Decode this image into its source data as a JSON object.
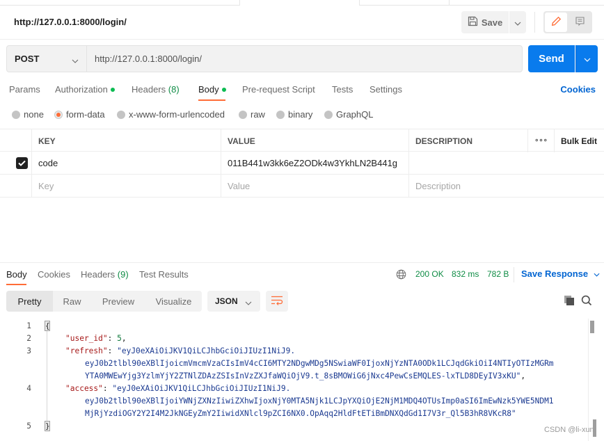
{
  "header": {
    "request_title": "http://127.0.0.1:8000/login/",
    "save_label": "Save"
  },
  "request": {
    "method": "POST",
    "url": "http://127.0.0.1:8000/login/",
    "send_label": "Send"
  },
  "request_tabs": {
    "params": "Params",
    "authorization": "Authorization",
    "headers": "Headers",
    "headers_count": "(8)",
    "body": "Body",
    "pre_request": "Pre-request Script",
    "tests": "Tests",
    "settings": "Settings",
    "cookies": "Cookies",
    "active": "Body"
  },
  "body_types": {
    "options": [
      "none",
      "form-data",
      "x-www-form-urlencoded",
      "raw",
      "binary",
      "GraphQL"
    ],
    "selected": "form-data"
  },
  "form_table": {
    "headers": {
      "key": "KEY",
      "value": "VALUE",
      "description": "DESCRIPTION",
      "more": "∘∘∘",
      "bulk_edit": "Bulk Edit"
    },
    "rows": [
      {
        "enabled": true,
        "key": "code",
        "value": "011B441w3kk6eZ2ODk4w3YkhLN2B441g",
        "description": ""
      }
    ],
    "placeholders": {
      "key": "Key",
      "value": "Value",
      "description": "Description"
    }
  },
  "response_tabs": {
    "body": "Body",
    "cookies": "Cookies",
    "headers": "Headers",
    "headers_count": "(9)",
    "test_results": "Test Results",
    "active": "Body"
  },
  "response_meta": {
    "status": "200 OK",
    "time": "832 ms",
    "size": "782 B",
    "save_response": "Save Response"
  },
  "view_modes": {
    "options": [
      "Pretty",
      "Raw",
      "Preview",
      "Visualize"
    ],
    "active": "Pretty",
    "format": "JSON"
  },
  "response_body": {
    "line_numbers": [
      "1",
      "2",
      "3",
      "4",
      "5"
    ],
    "open_brace": "{",
    "close_brace": "}",
    "user_id_key": "\"user_id\"",
    "user_id_value": "5",
    "refresh_key": "\"refresh\"",
    "refresh_lines": [
      "\"eyJ0eXAiOiJKV1QiLCJhbGciOiJIUzI1NiJ9.",
      "eyJ0b2tlbl90eXBlIjoicmVmcmVzaCIsImV4cCI6MTY2NDgwMDg5NSwiaWF0IjoxNjYzNTA0ODk1LCJqdGkiOiI4NTIyOTIzMGRm",
      "YTA0MWEwYjg3YzlmYjY2ZTNlZDAzZSIsInVzZXJfaWQiOjV9.t_8sBMOWiG6jNxc4PewCsEMQLES-lxTLD8DEyIV3xKU\""
    ],
    "access_key": "\"access\"",
    "access_lines": [
      "\"eyJ0eXAiOiJKV1QiLCJhbGciOiJIUzI1NiJ9.",
      "eyJ0b2tlbl90eXBlIjoiYWNjZXNzIiwiZXhwIjoxNjY0MTA5Njk1LCJpYXQiOjE2NjM1MDQ4OTUsImp0aSI6ImEwNzk5YWE5NDM1",
      "MjRjYzdiOGY2Y2I4M2JkNGEyZmY2IiwidXNlcl9pZCI6NX0.OpAqq2HldFtETiBmDNXQdGd1I7V3r_Ql5B3hR8VKcR8\""
    ]
  },
  "watermark": "CSDN @li-xun",
  "colors": {
    "accent_orange": "#ff6c37",
    "send_blue": "#097bed",
    "link_blue": "#0265d2",
    "status_green": "#0f8c45",
    "dot_green": "#0cbb52"
  }
}
